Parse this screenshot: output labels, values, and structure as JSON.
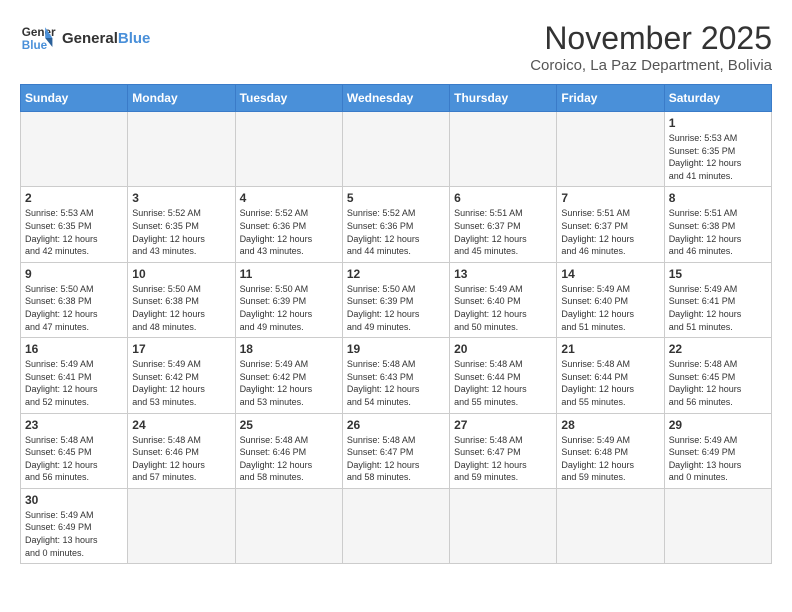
{
  "header": {
    "logo_general": "General",
    "logo_blue": "Blue",
    "month_title": "November 2025",
    "subtitle": "Coroico, La Paz Department, Bolivia"
  },
  "days_of_week": [
    "Sunday",
    "Monday",
    "Tuesday",
    "Wednesday",
    "Thursday",
    "Friday",
    "Saturday"
  ],
  "weeks": [
    [
      {
        "day": "",
        "info": ""
      },
      {
        "day": "",
        "info": ""
      },
      {
        "day": "",
        "info": ""
      },
      {
        "day": "",
        "info": ""
      },
      {
        "day": "",
        "info": ""
      },
      {
        "day": "",
        "info": ""
      },
      {
        "day": "1",
        "info": "Sunrise: 5:53 AM\nSunset: 6:35 PM\nDaylight: 12 hours\nand 41 minutes."
      }
    ],
    [
      {
        "day": "2",
        "info": "Sunrise: 5:53 AM\nSunset: 6:35 PM\nDaylight: 12 hours\nand 42 minutes."
      },
      {
        "day": "3",
        "info": "Sunrise: 5:52 AM\nSunset: 6:35 PM\nDaylight: 12 hours\nand 43 minutes."
      },
      {
        "day": "4",
        "info": "Sunrise: 5:52 AM\nSunset: 6:36 PM\nDaylight: 12 hours\nand 43 minutes."
      },
      {
        "day": "5",
        "info": "Sunrise: 5:52 AM\nSunset: 6:36 PM\nDaylight: 12 hours\nand 44 minutes."
      },
      {
        "day": "6",
        "info": "Sunrise: 5:51 AM\nSunset: 6:37 PM\nDaylight: 12 hours\nand 45 minutes."
      },
      {
        "day": "7",
        "info": "Sunrise: 5:51 AM\nSunset: 6:37 PM\nDaylight: 12 hours\nand 46 minutes."
      },
      {
        "day": "8",
        "info": "Sunrise: 5:51 AM\nSunset: 6:38 PM\nDaylight: 12 hours\nand 46 minutes."
      }
    ],
    [
      {
        "day": "9",
        "info": "Sunrise: 5:50 AM\nSunset: 6:38 PM\nDaylight: 12 hours\nand 47 minutes."
      },
      {
        "day": "10",
        "info": "Sunrise: 5:50 AM\nSunset: 6:38 PM\nDaylight: 12 hours\nand 48 minutes."
      },
      {
        "day": "11",
        "info": "Sunrise: 5:50 AM\nSunset: 6:39 PM\nDaylight: 12 hours\nand 49 minutes."
      },
      {
        "day": "12",
        "info": "Sunrise: 5:50 AM\nSunset: 6:39 PM\nDaylight: 12 hours\nand 49 minutes."
      },
      {
        "day": "13",
        "info": "Sunrise: 5:49 AM\nSunset: 6:40 PM\nDaylight: 12 hours\nand 50 minutes."
      },
      {
        "day": "14",
        "info": "Sunrise: 5:49 AM\nSunset: 6:40 PM\nDaylight: 12 hours\nand 51 minutes."
      },
      {
        "day": "15",
        "info": "Sunrise: 5:49 AM\nSunset: 6:41 PM\nDaylight: 12 hours\nand 51 minutes."
      }
    ],
    [
      {
        "day": "16",
        "info": "Sunrise: 5:49 AM\nSunset: 6:41 PM\nDaylight: 12 hours\nand 52 minutes."
      },
      {
        "day": "17",
        "info": "Sunrise: 5:49 AM\nSunset: 6:42 PM\nDaylight: 12 hours\nand 53 minutes."
      },
      {
        "day": "18",
        "info": "Sunrise: 5:49 AM\nSunset: 6:42 PM\nDaylight: 12 hours\nand 53 minutes."
      },
      {
        "day": "19",
        "info": "Sunrise: 5:48 AM\nSunset: 6:43 PM\nDaylight: 12 hours\nand 54 minutes."
      },
      {
        "day": "20",
        "info": "Sunrise: 5:48 AM\nSunset: 6:44 PM\nDaylight: 12 hours\nand 55 minutes."
      },
      {
        "day": "21",
        "info": "Sunrise: 5:48 AM\nSunset: 6:44 PM\nDaylight: 12 hours\nand 55 minutes."
      },
      {
        "day": "22",
        "info": "Sunrise: 5:48 AM\nSunset: 6:45 PM\nDaylight: 12 hours\nand 56 minutes."
      }
    ],
    [
      {
        "day": "23",
        "info": "Sunrise: 5:48 AM\nSunset: 6:45 PM\nDaylight: 12 hours\nand 56 minutes."
      },
      {
        "day": "24",
        "info": "Sunrise: 5:48 AM\nSunset: 6:46 PM\nDaylight: 12 hours\nand 57 minutes."
      },
      {
        "day": "25",
        "info": "Sunrise: 5:48 AM\nSunset: 6:46 PM\nDaylight: 12 hours\nand 58 minutes."
      },
      {
        "day": "26",
        "info": "Sunrise: 5:48 AM\nSunset: 6:47 PM\nDaylight: 12 hours\nand 58 minutes."
      },
      {
        "day": "27",
        "info": "Sunrise: 5:48 AM\nSunset: 6:47 PM\nDaylight: 12 hours\nand 59 minutes."
      },
      {
        "day": "28",
        "info": "Sunrise: 5:49 AM\nSunset: 6:48 PM\nDaylight: 12 hours\nand 59 minutes."
      },
      {
        "day": "29",
        "info": "Sunrise: 5:49 AM\nSunset: 6:49 PM\nDaylight: 13 hours\nand 0 minutes."
      }
    ],
    [
      {
        "day": "30",
        "info": "Sunrise: 5:49 AM\nSunset: 6:49 PM\nDaylight: 13 hours\nand 0 minutes."
      },
      {
        "day": "",
        "info": ""
      },
      {
        "day": "",
        "info": ""
      },
      {
        "day": "",
        "info": ""
      },
      {
        "day": "",
        "info": ""
      },
      {
        "day": "",
        "info": ""
      },
      {
        "day": "",
        "info": ""
      }
    ]
  ]
}
